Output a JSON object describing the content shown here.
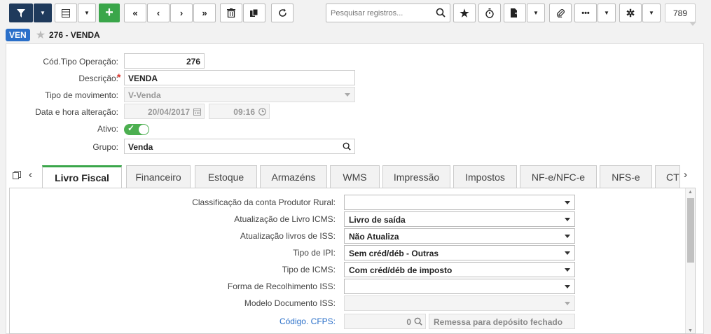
{
  "toolbar": {
    "search_placeholder": "Pesquisar registros...",
    "record_count": "789"
  },
  "header": {
    "badge": "VEN",
    "title": "276 - VENDA"
  },
  "form": {
    "cod_tipo_label": "Cód.Tipo Operação:",
    "cod_tipo_value": "276",
    "descricao_label": "Descrição:",
    "descricao_value": "VENDA",
    "tipo_mov_label": "Tipo de movimento:",
    "tipo_mov_value": "V-Venda",
    "data_label": "Data e hora alteração:",
    "data_value": "20/04/2017",
    "hora_value": "09:16",
    "ativo_label": "Ativo:",
    "ativo_on": true,
    "grupo_label": "Grupo:",
    "grupo_value": "Venda"
  },
  "tabs": [
    {
      "label": "Livro Fiscal",
      "active": true
    },
    {
      "label": "Financeiro"
    },
    {
      "label": "Estoque"
    },
    {
      "label": "Armazéns"
    },
    {
      "label": "WMS"
    },
    {
      "label": "Impressão"
    },
    {
      "label": "Impostos"
    },
    {
      "label": "NF-e/NFC-e"
    },
    {
      "label": "NFS-e"
    },
    {
      "label": "CT"
    }
  ],
  "panel": {
    "rows": [
      {
        "label": "Classificação da conta Produtor Rural:",
        "value": ""
      },
      {
        "label": "Atualização de Livro ICMS:",
        "value": "Livro de saída"
      },
      {
        "label": "Atualização livros de ISS:",
        "value": "Não Atualiza"
      },
      {
        "label": "Tipo de IPI:",
        "value": "Sem créd/déb - Outras"
      },
      {
        "label": "Tipo de ICMS:",
        "value": "Com créd/déb de imposto"
      },
      {
        "label": "Forma de Recolhimento ISS:",
        "value": ""
      },
      {
        "label": "Modelo Documento ISS:",
        "value": ""
      }
    ],
    "cfps_label": "Código. CFPS:",
    "cfps_code": "0",
    "cfps_desc": "Remessa para depósito fechado"
  }
}
